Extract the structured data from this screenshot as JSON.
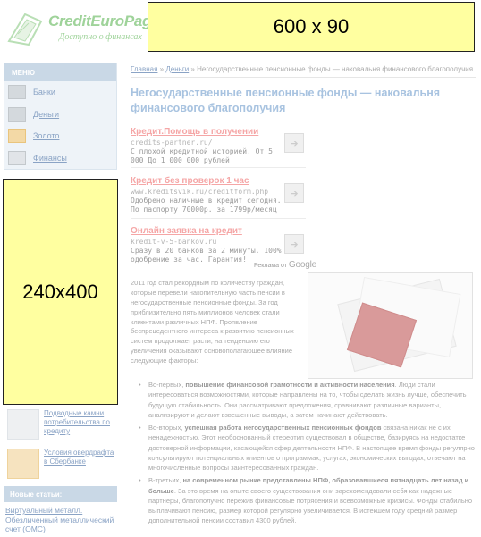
{
  "header": {
    "logo_name": "CreditEuroPages",
    "logo_tagline": "Доступно о финансах",
    "top_banner": "600 x 90"
  },
  "menu": {
    "title": "МЕНЮ",
    "items": [
      {
        "label": "Банки",
        "icon": "bank-icon"
      },
      {
        "label": "Деньги",
        "icon": "money-icon"
      },
      {
        "label": "Золото",
        "icon": "gold-icon"
      },
      {
        "label": "Финансы",
        "icon": "finance-icon"
      }
    ]
  },
  "side_banner": "240x400",
  "promos": [
    {
      "text": "Подводные камни потребительства по кредиту"
    },
    {
      "text": "Условия овердрафта в Сбербанке"
    }
  ],
  "new_articles": {
    "title": "Новые статьи:",
    "link": "Виртуальный металл. Обезличенный металлический счет (ОМС)"
  },
  "breadcrumb": {
    "home": "Главная",
    "section": "Деньги",
    "current": "Негосударственные пенсионные фонды — наковальня финансового благополучия"
  },
  "article": {
    "title": "Негосударственные пенсионные фонды — наковальня финансового благополучия",
    "intro": "2011 год стал рекордным по количеству граждан, которые перевели накопительную часть пенсии в негосударственные пенсионные фонды. За год приблизительно пять миллионов человек стали клиентами различных НПФ. Проявление беспрецедентного интереса к развитию пенсионных систем продолжает расти, на тенденцию его увеличения оказывают основополагающее влияние следующие факторы:",
    "bullets": [
      {
        "lead": "Во-первых, ",
        "bold": "повышение финансовой грамотности и активности населения",
        "rest": ". Люди стали интересоваться возможностями, которые направлены на то, чтобы сделать жизнь лучше, обеспечить будущую стабильность. Они рассматривают предложения, сравнивают различные варианты, анализируют и делают взвешенные выводы, а затем начинают действовать."
      },
      {
        "lead": "Во-вторых, ",
        "bold": "успешная работа негосударственных пенсионных фондов",
        "rest": " связана никак не с их ненадежностью. Этот необоснованный стереотип существовал в обществе, базируясь на недостатке достоверной информации, касающейся сфер деятельности НПФ. В настоящее время фонды регулярно консультируют потенциальных клиентов о программах, услугах, экономических выгодах, отвечают на многочисленные вопросы заинтересованных граждан."
      },
      {
        "lead": "В-третьих, ",
        "bold": "на современном рынке представлены НПФ, образовавшиеся пятнадцать лет назад и больше",
        "rest": ". За это время на опыте своего существования они зарекомендовали себя как надежные партнеры, благополучно пережив финансовые потрясения и всевозможные кризисы. Фонды стабильно выплачивают пенсию, размер которой регулярно увеличивается. В истекшем году средний размер дополнительной пенсии составил 4300 рублей."
      }
    ]
  },
  "ads": [
    {
      "title": "Кредит.Помощь в получении",
      "url": "credits-partner.ru/",
      "desc": "С плохой кредитной историей. От 5 000 До 1 000 000 рублей"
    },
    {
      "title": "Кредит без проверок 1 час",
      "url": "www.kreditsvik.ru/creditform.php",
      "desc": "Одобрено наличные в кредит сегодня. По паспорту 70000р. за 1799р/месяц"
    },
    {
      "title": "Онлайн заявка на кредит",
      "url": "kredit-v-5-bankov.ru",
      "desc": "Сразу в 20 банков за 2 минуты. 100% одобрение за час. Гарантия!"
    }
  ],
  "ads_by": {
    "text": "Реклама от",
    "brand": "Google"
  },
  "colors": {
    "banner_yellow": "#ffffa0",
    "menu_header": "#c9d8e6",
    "link": "#8aa3c5",
    "title": "#a8c3e0",
    "ad_title": "#f5a6a6",
    "logo": "#9fd39a"
  }
}
